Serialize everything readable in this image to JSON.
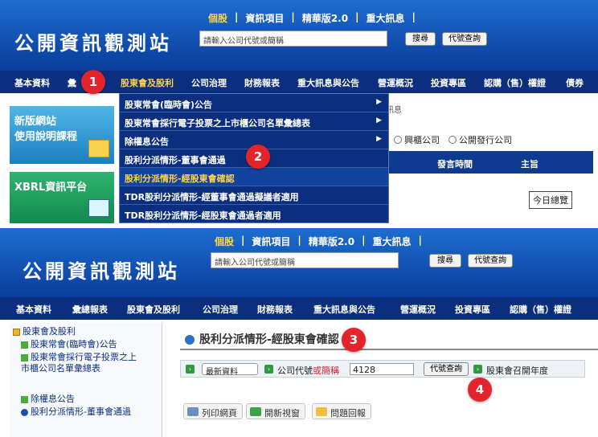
{
  "site_title": "公開資訊觀測站",
  "top_links": [
    "個股",
    "資訊項目",
    "精華版2.0",
    "重大訊息"
  ],
  "search_placeholder": "請輸入公司代號或簡稱",
  "search_button": "搜尋",
  "code_query_button": "代號查詢",
  "nav_top": [
    "基本資料",
    "彙",
    "股東會及股利",
    "公司治理",
    "財務報表",
    "重大訊息與公告",
    "營運概況",
    "投資專區",
    "認購（售）權證",
    "債券"
  ],
  "nav_bottom": [
    "基本資料",
    "彙總報表",
    "股東會及股利",
    "公司治理",
    "財務報表",
    "重大訊息與公告",
    "營運概況",
    "投資專區",
    "認購（售）權證"
  ],
  "dropdown": [
    {
      "label": "股東常會(臨時會)公告",
      "arrow": "▶"
    },
    {
      "label": "股東常會採行電子投票之上市櫃公司名單彙總表",
      "arrow": "▶"
    },
    {
      "label": "除權息公告",
      "arrow": "▶"
    },
    {
      "label": "股利分派情形-董事會通過",
      "arrow": ""
    },
    {
      "label": "股利分派情形-經股東會確認",
      "arrow": ""
    },
    {
      "label": "TDR股利分派情形-經董事會通過擬議者適用",
      "arrow": ""
    },
    {
      "label": "TDR股利分派情形-經股東會通過者適用",
      "arrow": ""
    }
  ],
  "banner_1": [
    "新版網站",
    "使用說明課程"
  ],
  "banner_2": "XBRL資訊平台",
  "right_tab_text": "訊息",
  "radios": [
    "興櫃公司",
    "公開發行公司"
  ],
  "table_headers": [
    "發言時間",
    "主旨"
  ],
  "today_button": "今日總覽",
  "sidebar": {
    "root": "股東會及股利",
    "items": [
      "股東常會(臨時會)公告",
      "股東常會採行電子投票之上市櫃公司名單彙總表",
      "除權息公告",
      "股利分派情形-董事會通過"
    ]
  },
  "page_title": "股利分派情形-經股東會確認",
  "toolbar": {
    "select_value": "最新資料",
    "code_label": "公司代號",
    "or_label": "或",
    "name_label": "簡稱",
    "code_value": "4128",
    "query_button": "代號查詢",
    "year_label": "股東會召開年度"
  },
  "actions": [
    "列印網頁",
    "開新視窗",
    "問題回報"
  ],
  "callouts": [
    "1",
    "2",
    "3",
    "4"
  ],
  "colors": {
    "nav_bg": "#0b2f7e",
    "active": "#ffd24a",
    "callout": "#e3242b"
  }
}
